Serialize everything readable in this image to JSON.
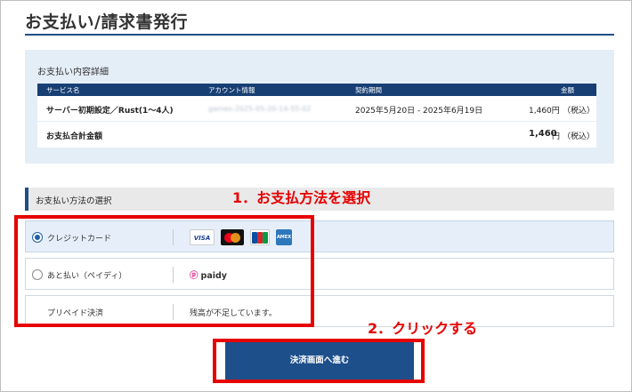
{
  "page": {
    "title": "お支払い/請求書発行"
  },
  "details": {
    "title": "お支払い内容詳細",
    "headers": [
      "サービス名",
      "アカウント情報",
      "契約期間",
      "金額"
    ],
    "row": {
      "service": "サーバー初期設定／Rust(1〜4人)",
      "account": "games-2025-05-20-14-55-02",
      "period": "2025年5月20日 - 2025年6月19日",
      "amount": "1,460円",
      "tax": "（税込）"
    },
    "total": {
      "label": "お支払合計金額",
      "amount": "1,460",
      "unit": "円",
      "tax": "（税込）"
    }
  },
  "method": {
    "title": "お支払い方法の選択",
    "options": [
      {
        "label": "クレジットカード",
        "selected": true,
        "brands": [
          "VISA",
          "Mastercard",
          "JCB",
          "AMEX"
        ]
      },
      {
        "label": "あと払い（ペイディ）",
        "selected": false,
        "brand": "paidy",
        "brand_mark": "ⓟ"
      },
      {
        "label": "プリペイド決済",
        "note": "残高が不足しています。"
      }
    ]
  },
  "button": {
    "label": "決済画面へ進む"
  },
  "annotations": {
    "step1": "1．お支払方法を選択",
    "step2": "2．クリックする",
    "color": "#e60000"
  },
  "colors": {
    "primary": "#1d4f8a",
    "header": "#173f73",
    "panel": "#e4eef7"
  },
  "card_text": {
    "visa": "VISA",
    "amex": "AMEX"
  }
}
